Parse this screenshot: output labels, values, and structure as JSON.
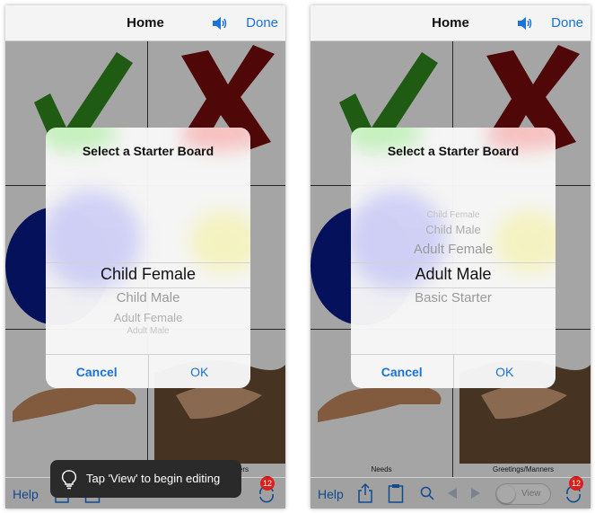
{
  "left": {
    "nav": {
      "title": "Home",
      "done_label": "Done",
      "speaker_icon": "speaker-icon"
    },
    "dialog": {
      "title": "Select a Starter Board",
      "picker_items": [
        "Child Female",
        "Child Male",
        "Adult Female",
        "Adult Male"
      ],
      "selected": "Child Female",
      "cancel_label": "Cancel",
      "ok_label": "OK"
    },
    "board": {
      "label_right": "Greetings/Manners"
    },
    "toolbar": {
      "help_label": "Help",
      "badge_count": "12"
    },
    "hint": {
      "text": "Tap 'View' to begin editing",
      "icon": "lightbulb-icon"
    }
  },
  "right": {
    "nav": {
      "title": "Home",
      "done_label": "Done",
      "speaker_icon": "speaker-icon"
    },
    "dialog": {
      "title": "Select a Starter Board",
      "picker_items": [
        "Child Female",
        "Child Male",
        "Adult Female",
        "Adult Male",
        "Basic Starter"
      ],
      "selected": "Adult Male",
      "cancel_label": "Cancel",
      "ok_label": "OK"
    },
    "board": {
      "label_left": "Needs",
      "label_right": "Greetings/Manners"
    },
    "toolbar": {
      "help_label": "Help",
      "view_label": "View",
      "badge_count": "12"
    }
  },
  "colors": {
    "accent": "#1a73d9",
    "check": "#2f8a1c",
    "cross": "#7a0c0c",
    "circle": "#0a1a8a",
    "badge": "#d9201d"
  }
}
